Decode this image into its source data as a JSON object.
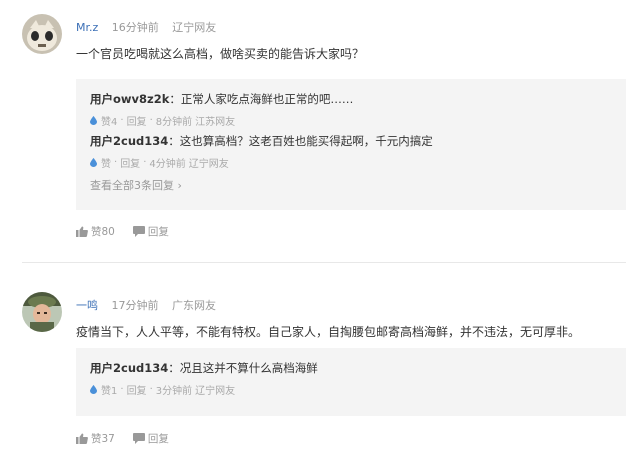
{
  "comments": [
    {
      "username": "Mr.z",
      "time": "16分钟前",
      "location": "辽宁网友",
      "text": "一个官员吃喝就这么高档，做啥买卖的能告诉大家吗？",
      "replies": [
        {
          "user": "用户owv8z2k",
          "text": "：正常人家吃点海鲜也正常的吧……",
          "like": "赞4",
          "reply_label": "回复",
          "time": "8分钟前",
          "location": "江苏网友"
        },
        {
          "user": "用户2cud134",
          "text": "：这也算高档？这老百姓也能买得起啊，千元内搞定",
          "like": "赞",
          "reply_label": "回复",
          "time": "4分钟前",
          "location": "辽宁网友"
        }
      ],
      "view_all": "查看全部3条回复",
      "likes": "赞80",
      "reply_label": "回复"
    },
    {
      "username": "一鸣",
      "time": "17分钟前",
      "location": "广东网友",
      "text": "疫情当下，人人平等，不能有特权。自己家人，自掏腰包邮寄高档海鲜，并不违法，无可厚非。",
      "replies": [
        {
          "user": "用户2cud134",
          "text": "：况且这并不算什么高档海鲜",
          "like": "赞1",
          "reply_label": "回复",
          "time": "3分钟前",
          "location": "辽宁网友"
        }
      ],
      "likes": "赞37",
      "reply_label": "回复"
    }
  ],
  "colors": {
    "username": "#3b6fb6",
    "like_drop": "#4a90d9",
    "reply_bg": "#f4f4f4"
  }
}
